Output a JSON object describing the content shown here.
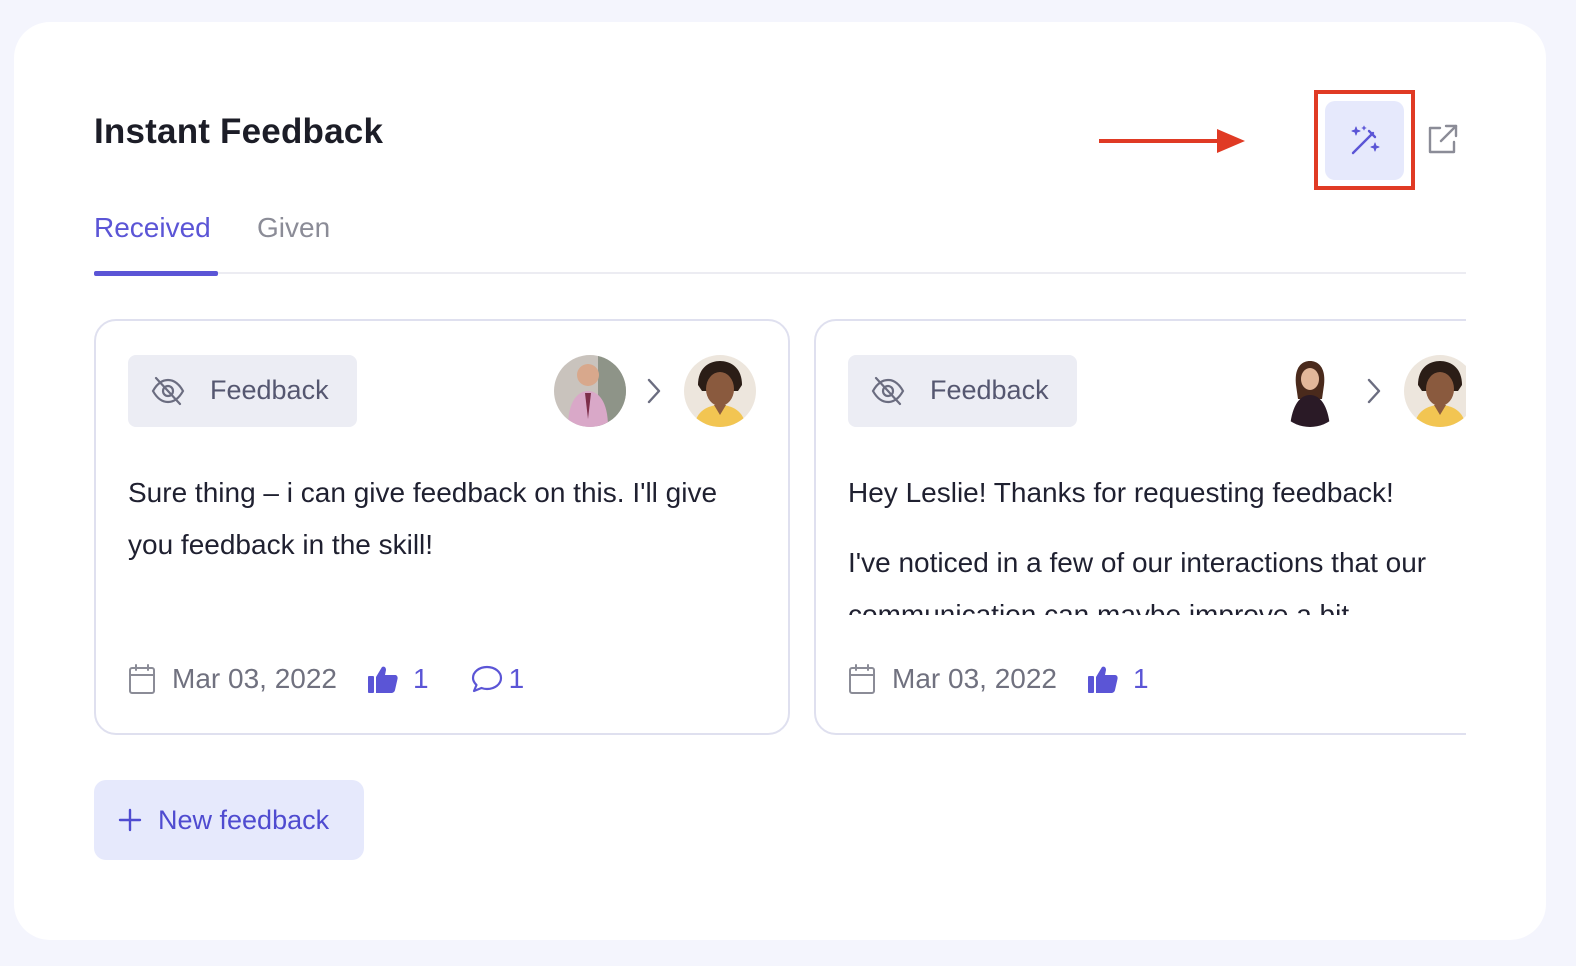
{
  "header": {
    "title": "Instant Feedback"
  },
  "toolbar": {
    "magic_icon": "magic-wand-sparkles-icon",
    "external_icon": "external-link-icon",
    "annotation_color": "#e03a24"
  },
  "tabs": [
    {
      "label": "Received",
      "active": true
    },
    {
      "label": "Given",
      "active": false
    }
  ],
  "cards": [
    {
      "badge_label": "Feedback",
      "badge_icon": "eye-off-icon",
      "from_avatar": "avatar",
      "to_avatar": "avatar",
      "text": "Sure thing – i can give feedback on this. I'll give you feedback in the skill!",
      "date": "Mar 03, 2022",
      "likes": "1",
      "comments": "1"
    },
    {
      "badge_label": "Feedback",
      "badge_icon": "eye-off-icon",
      "from_avatar": "avatar",
      "to_avatar": "avatar",
      "text_1": "Hey Leslie! Thanks for requesting feedback!",
      "text_2": "I've noticed in a few of our interactions that our communication can maybe improve a bit..",
      "date": "Mar 03, 2022",
      "likes": "1"
    }
  ],
  "actions": {
    "new_feedback_label": "New feedback"
  },
  "colors": {
    "accent": "#5b55d6",
    "accent_bg": "#e6e9fc",
    "badge_bg": "#ecedf4"
  }
}
